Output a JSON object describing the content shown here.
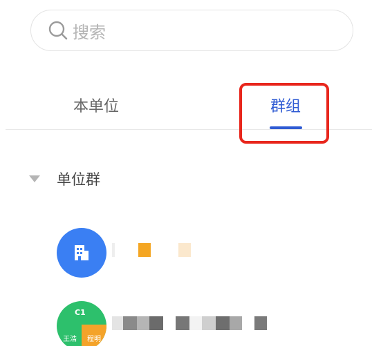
{
  "search": {
    "placeholder": "搜索"
  },
  "tabs": [
    {
      "label": "本单位",
      "active": false
    },
    {
      "label": "群组",
      "active": true
    }
  ],
  "colors": {
    "accent": "#2f5bd3",
    "highlight": "#e8261c",
    "avatar_blue": "#3a7ff3",
    "avatar_green": "#2dc06c",
    "avatar_orange": "#f4a32a"
  },
  "section": {
    "title": "单位群",
    "expanded": true
  },
  "groups": [
    {
      "avatar_type": "building-icon",
      "name_blurred": true
    },
    {
      "avatar_code": "C1",
      "avatar_members": [
        "王浩",
        "程明"
      ],
      "name_blurred": true
    }
  ]
}
